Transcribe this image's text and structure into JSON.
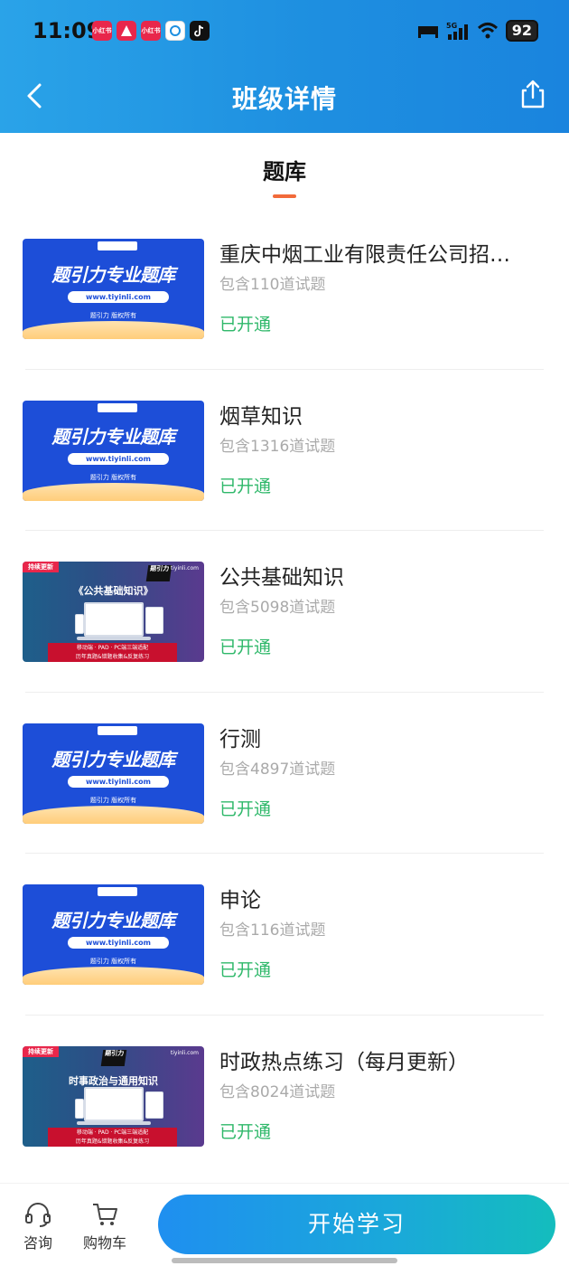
{
  "status_bar": {
    "time": "11:09",
    "battery": "92",
    "network": "5G",
    "app_icons": [
      {
        "name": "xiaohongshu-icon",
        "label": "小红书"
      },
      {
        "name": "app-a-icon",
        "label": ""
      },
      {
        "name": "xiaohongshu-icon-2",
        "label": "小红书"
      },
      {
        "name": "headset-app-icon",
        "label": ""
      },
      {
        "name": "tiktok-icon",
        "label": ""
      }
    ]
  },
  "header": {
    "title": "班级详情",
    "back_icon": "chevron-left-icon",
    "share_icon": "share-icon"
  },
  "tab": {
    "label": "题库",
    "accent": "#f26a3a"
  },
  "items": [
    {
      "title": "重庆中烟工业有限责任公司招…",
      "count": "包含110道试题",
      "status": "已开通",
      "thumb": {
        "type": "blue",
        "headline": "题引力专业题库",
        "url": "www.tiyinli.com",
        "copyright": "题引力 版权所有"
      }
    },
    {
      "title": "烟草知识",
      "count": "包含1316道试题",
      "status": "已开通",
      "thumb": {
        "type": "blue",
        "headline": "题引力专业题库",
        "url": "www.tiyinli.com",
        "copyright": "题引力 版权所有"
      }
    },
    {
      "title": "公共基础知识",
      "count": "包含5098道试题",
      "status": "已开通",
      "thumb": {
        "type": "purple",
        "tag": "持续更新",
        "logo": "题引力",
        "url": "tiyinli.com",
        "subject": "《公共基础知识》",
        "band_line1": "移动端 · PAD · PC端三端适配",
        "band_line2": "历年真题&错题收集&反复练习"
      }
    },
    {
      "title": "行测",
      "count": "包含4897道试题",
      "status": "已开通",
      "thumb": {
        "type": "blue",
        "headline": "题引力专业题库",
        "url": "www.tiyinli.com",
        "copyright": "题引力 版权所有"
      }
    },
    {
      "title": "申论",
      "count": "包含116道试题",
      "status": "已开通",
      "thumb": {
        "type": "blue",
        "headline": "题引力专业题库",
        "url": "www.tiyinli.com",
        "copyright": "题引力 版权所有"
      }
    },
    {
      "title": "时政热点练习（每月更新）",
      "count": "包含8024道试题",
      "status": "已开通",
      "thumb": {
        "type": "purple",
        "tag": "持续更新",
        "logo": "题引力",
        "url": "tiyinli.com",
        "subject": "时事政治与通用知识",
        "band_line1": "移动端 · PAD · PC端三端适配",
        "band_line2": "历年真题&错题收集&反复练习"
      }
    }
  ],
  "bottom_bar": {
    "consult_label": "咨询",
    "cart_label": "购物车",
    "start_label": "开始学习"
  },
  "colors": {
    "header_gradient_start": "#2aa3e8",
    "header_gradient_end": "#1a84de",
    "status_green": "#2fb86a",
    "button_gradient_start": "#1f8ff0",
    "button_gradient_end": "#14bdbd"
  }
}
